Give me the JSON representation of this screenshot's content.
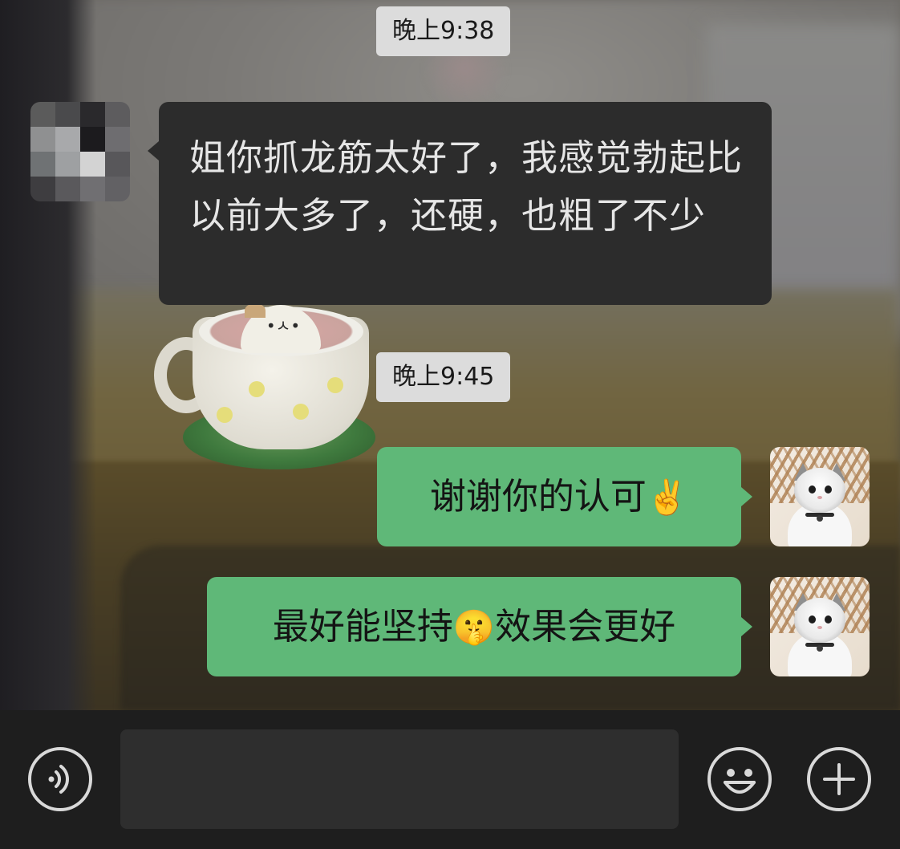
{
  "chat": {
    "time_1": "晚上9:38",
    "time_2": "晚上9:45",
    "incoming": {
      "text": "姐你抓龙筋太好了，我感觉勃起比以前大多了，还硬，也粗了不少"
    },
    "outgoing_1": {
      "text": "谢谢你的认可",
      "emoji": "✌️",
      "emoji_icon": "victory-hand-icon"
    },
    "outgoing_2": {
      "text_before": "最好能坚持",
      "emoji": "🤫",
      "emoji_icon": "determined-face-icon",
      "text_after": "效果会更好"
    }
  },
  "input_bar": {
    "message_value": "",
    "icons": {
      "voice": "voice-input-icon",
      "emoji": "emoji-face-icon",
      "more": "plus-icon"
    }
  },
  "colors": {
    "outgoing_bubble": "#5fb878",
    "incoming_bubble": "#2c2c2c",
    "time_chip": "#dcdcdc",
    "input_bar": "#1e1e1e",
    "input_field": "#2e2e2e"
  }
}
